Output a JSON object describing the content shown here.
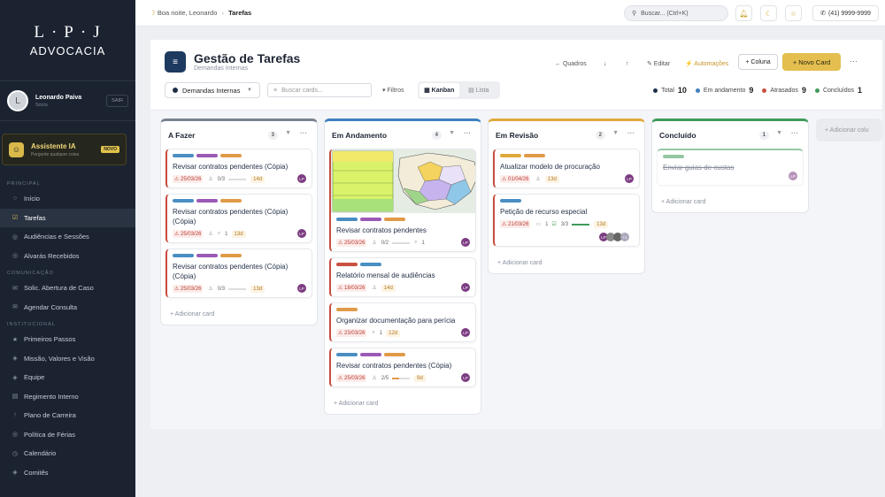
{
  "brand": {
    "line1": "L·P·J",
    "line2": "ADVOCACIA"
  },
  "user": {
    "initial": "L",
    "name": "Leonardo Paiva",
    "role": "Sócio",
    "logout": "SAIR"
  },
  "assistant": {
    "icon": "bot-icon",
    "title": "Assistente IA",
    "subtitle": "Pergunte qualquer coisa",
    "badge": "NOVO"
  },
  "sidebar": {
    "sec_principal": "PRINCIPAL",
    "sec_comunicacao": "COMUNICAÇÃO",
    "sec_institucional": "INSTITUCIONAL",
    "principal": [
      {
        "icon": "○",
        "label": "Início"
      },
      {
        "icon": "☑",
        "label": "Tarefas"
      },
      {
        "icon": "◎",
        "label": "Audiências e Sessões"
      },
      {
        "icon": "◎",
        "label": "Alvarás Recebidos"
      }
    ],
    "comunicacao": [
      {
        "icon": "✉",
        "label": "Solic. Abertura de Caso"
      },
      {
        "icon": "✉",
        "label": "Agendar Consulta"
      }
    ],
    "institucional": [
      {
        "icon": "★",
        "label": "Primeiros Passos"
      },
      {
        "icon": "◈",
        "label": "Missão, Valores e Visão"
      },
      {
        "icon": "◈",
        "label": "Equipe"
      },
      {
        "icon": "▤",
        "label": "Regimento Interno"
      },
      {
        "icon": "↑",
        "label": "Plano de Carreira"
      },
      {
        "icon": "◎",
        "label": "Política de Férias"
      },
      {
        "icon": "◷",
        "label": "Calendário"
      },
      {
        "icon": "◈",
        "label": "Comitês"
      }
    ]
  },
  "topbar": {
    "greeting": "Boa noite, Leonardo",
    "sep": "›",
    "crumb": "Tarefas",
    "search_placeholder": "Buscar... (Ctrl+K)",
    "phone": "(41)  9999-9999"
  },
  "header": {
    "title": "Gestão de Tarefas",
    "subtitle": "Demandas Internas",
    "quadros": "← Quadros",
    "export": "↓",
    "import": "↑",
    "editar": "✎ Editar",
    "automacoes": "⚡ Automações",
    "coluna": "+ Coluna",
    "novo_card": "+ Novo Card",
    "more": "···"
  },
  "toolbar": {
    "board": "Demandas Internas",
    "search_placeholder": "Buscar cards...",
    "filters": "▾ Filtros",
    "kanban": "▦ Kanban",
    "lista": "▤ Lista",
    "total_label": "Total",
    "total": "10",
    "andamento_label": "Em andamento",
    "andamento": "9",
    "atrasados_label": "Atrasados",
    "atrasados": "9",
    "concluidos_label": "Concluídos",
    "concluidos": "1"
  },
  "colors": {
    "blue": "#4a8ec2",
    "purple": "#9b59b6",
    "orange": "#e09a47",
    "red": "#c9503f",
    "green": "#3f9b5a",
    "navy": "#1e3a5f",
    "gold": "#e4bf4f"
  },
  "columns": [
    {
      "title": "A Fazer",
      "count": "3",
      "accent": "#7a8290",
      "add": "+ Adicionar card"
    },
    {
      "title": "Em Andamento",
      "count": "4",
      "accent": "#3f7fbf",
      "add": "+ Adicionar card"
    },
    {
      "title": "Em Revisão",
      "count": "2",
      "accent": "#e0a93b",
      "add": "+ Adicionar card"
    },
    {
      "title": "Concluído",
      "count": "1",
      "accent": "#3f9b5a",
      "add": "+ Adicionar card"
    }
  ],
  "ghost_column": "+ Adicionar colu",
  "cards": {
    "a1": {
      "title": "Revisar contratos pendentes (Cópia)",
      "date": "⚠ 25/03/26",
      "checks": "0/3",
      "days": "14d",
      "av": "LP"
    },
    "a2": {
      "title": "Revisar contratos pendentes (Cópia) (Cópia)",
      "date": "⚠ 25/03/26",
      "att": "1",
      "days": "13d",
      "av": "LP"
    },
    "a3": {
      "title": "Revisar contratos pendentes (Cópia) (Cópia)",
      "date": "⚠ 25/03/26",
      "checks": "0/3",
      "days": "13d",
      "av": "LP"
    },
    "b1": {
      "title": "Revisar contratos pendentes",
      "date": "⚠ 25/03/26",
      "checks": "0/2",
      "att": "1",
      "av": "LP"
    },
    "b2": {
      "title": "Relatório mensal de audiências",
      "date": "⚠ 18/03/26",
      "days": "14d",
      "av": "LP"
    },
    "b3": {
      "title": "Organizar documentação para perícia",
      "date": "⚠ 23/03/26",
      "att": "1",
      "days": "12d",
      "av": "LP"
    },
    "b4": {
      "title": "Revisar contratos pendentes (Cópia)",
      "date": "⚠ 25/03/26",
      "checks": "2/5",
      "days": "9d",
      "av": "LP"
    },
    "c1": {
      "title": "Atualizar modelo de procuração",
      "date": "⚠ 01/04/26",
      "days": "13d",
      "av": "LP"
    },
    "c2": {
      "title": "Petição de recurso especial",
      "date": "⚠ 21/03/26",
      "comments": "1",
      "checks": "3/3",
      "days": "13d",
      "av": "LP",
      "extra": "+1"
    },
    "d1": {
      "title": "Enviar guias de custas",
      "av": "LP"
    }
  }
}
